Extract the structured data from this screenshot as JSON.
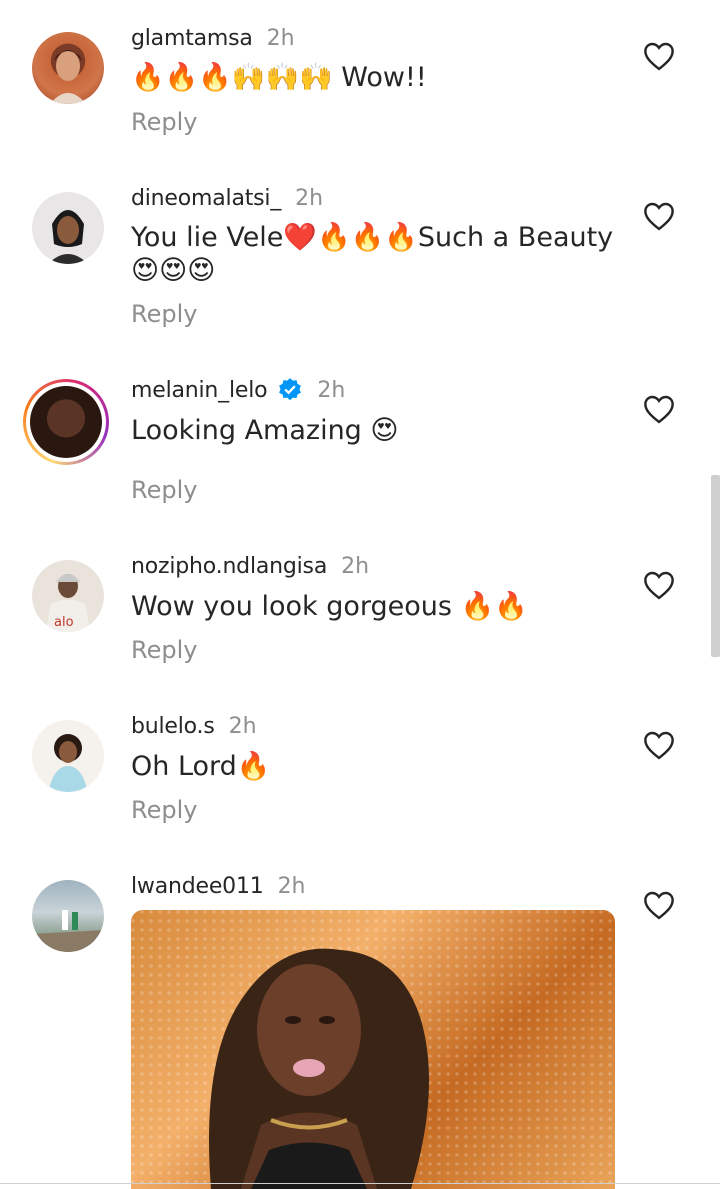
{
  "comments": [
    {
      "username": "glamtamsa",
      "time": "2h",
      "text": "🔥🔥🔥🙌🙌🙌 Wow!!",
      "reply": "Reply"
    },
    {
      "username": "dineomalatsi_",
      "time": "2h",
      "text_line1": "You lie Vele❤️🔥🔥🔥Such a Beauty",
      "text_line2": "😍😍😍",
      "reply": "Reply"
    },
    {
      "username": "melanin_lelo",
      "time": "2h",
      "text": "Looking Amazing 😍",
      "reply": "Reply",
      "verified": true
    },
    {
      "username": "nozipho.ndlangisa",
      "time": "2h",
      "text": "Wow you look gorgeous 🔥🔥",
      "reply": "Reply"
    },
    {
      "username": "bulelo.s",
      "time": "2h",
      "text": "Oh Lord🔥",
      "reply": "Reply"
    },
    {
      "username": "lwandee011",
      "time": "2h",
      "has_image": true
    }
  ],
  "icons": {
    "like": "heart-outline-icon",
    "verified": "verified-badge-icon"
  },
  "colors": {
    "text": "#262626",
    "secondary": "#8e8e8e",
    "verified": "#0095f6"
  }
}
